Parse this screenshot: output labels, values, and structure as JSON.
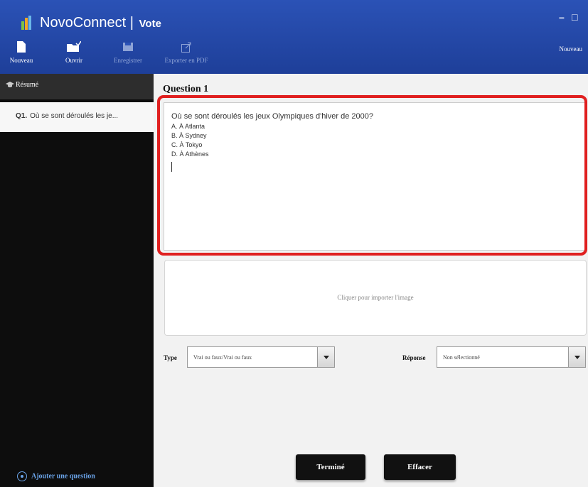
{
  "app": {
    "name": "NovoConnect",
    "separator": "|",
    "subtitle": "Vote",
    "minimize_glyph": "–",
    "maximize_glyph": "□"
  },
  "toolbar": {
    "new_label": "Nouveau",
    "open_label": "Ouvrir",
    "save_label": "Enregistrer",
    "export_label": "Exporter en PDF",
    "new_right_label": "Nouveau"
  },
  "sidebar": {
    "header": "Résumé",
    "items": [
      {
        "num": "Q1.",
        "text": "Où se sont déroulés les je..."
      }
    ],
    "add_question": "Ajouter une question"
  },
  "question": {
    "title": "Question 1",
    "text": "Où se sont déroulés les jeux Olympiques d'hiver de 2000?",
    "options": [
      "A.  À Atlanta",
      "B.  À Sydney",
      "C.  À Tokyo",
      "D.  À Athènes"
    ]
  },
  "image_box": {
    "placeholder": "Cliquer pour importer l'image"
  },
  "type_field": {
    "label": "Type",
    "value": "Vrai ou faux/Vrai ou faux"
  },
  "answer_field": {
    "label": "Réponse",
    "value": "Non sélectionné"
  },
  "buttons": {
    "done": "Terminé",
    "clear": "Effacer"
  },
  "colors": {
    "header": "#2b52b6",
    "highlight": "#e02020",
    "sidebar": "#0d0d0d"
  }
}
